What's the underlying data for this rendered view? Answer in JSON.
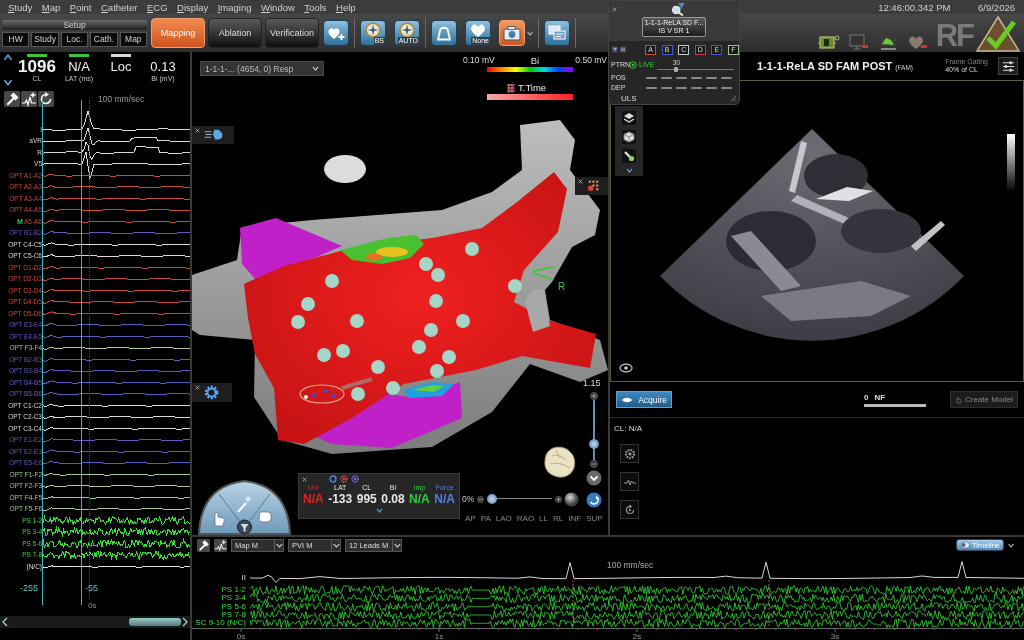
{
  "menu_bar": {
    "items": [
      "Study",
      "Map",
      "Point",
      "Catheter",
      "ECG",
      "Display",
      "Imaging",
      "Window",
      "Tools",
      "Help"
    ],
    "time": "12:46:00.342 PM",
    "date": "6/9/2026"
  },
  "toolbar": {
    "setup_label": "Setup",
    "setup_buttons": [
      "HW",
      "Study",
      "Loc.",
      "Cath.",
      "Map"
    ],
    "mode_tabs": [
      {
        "label": "Mapping",
        "selected": true
      },
      {
        "label": "Ablation",
        "selected": false
      },
      {
        "label": "Verification",
        "selected": false
      }
    ],
    "tool_groups": [
      [
        {
          "kind": "heart-plus",
          "selected": false
        }
      ],
      [
        {
          "kind": "compass",
          "badge": "BS",
          "selected": false
        },
        {
          "kind": "compass",
          "badge": "AUTO",
          "selected": false
        }
      ],
      [
        {
          "kind": "arch",
          "selected": false
        },
        {
          "kind": "heart",
          "badge": "None",
          "selected": false
        },
        {
          "kind": "camera",
          "selected": true
        }
      ],
      [
        {
          "kind": "screens",
          "selected": false
        }
      ]
    ],
    "logo": "RF"
  },
  "uls_panel": {
    "clip_title": "1-1-1-ReLA SD F...",
    "clip_subtitle": "IS V SR 1",
    "channels": [
      {
        "label": "A",
        "color": "#d04a30"
      },
      {
        "label": "B",
        "color": "#4a58c8"
      },
      {
        "label": "C",
        "color": "#c8c8c8"
      },
      {
        "label": "D",
        "color": "#d03838"
      },
      {
        "label": "E",
        "color": "#4a58c8"
      },
      {
        "label": "F",
        "color": "#9ac28e"
      }
    ],
    "pattern_label": "PTRN",
    "live": "LIVE",
    "gain": {
      "value": "30",
      "level": 0.25
    },
    "rows": [
      "POS",
      "DEP"
    ],
    "name": "ULS"
  },
  "ecg_panel": {
    "readouts": [
      {
        "value": "1096",
        "label": "CL",
        "color": "#3cc43c"
      },
      {
        "value": "N/A",
        "label": "LAT (ms)",
        "color": "#3cc43c"
      },
      {
        "value": "Loc",
        "color": "#d8d8d8"
      },
      {
        "value": "0.13",
        "label": "Bi (mV)"
      }
    ],
    "speed": "100 mm/sec",
    "channels": [
      {
        "name": "I",
        "kind": "ecg",
        "color": "#d8d8d8"
      },
      {
        "name": "aVR",
        "kind": "ecg",
        "color": "#d8d8d8"
      },
      {
        "name": "R",
        "kind": "ecg",
        "color": "#d8d8d8"
      },
      {
        "name": "V5",
        "kind": "ecg",
        "color": "#d8d8d8"
      },
      {
        "name": "OPT A1-A2",
        "kind": "flat",
        "color": "#c8483c"
      },
      {
        "name": "OPT A2-A3",
        "kind": "flat",
        "color": "#c8483c"
      },
      {
        "name": "OPT A3-A4",
        "kind": "flat",
        "color": "#c8483c"
      },
      {
        "name": "OPT A4-A5",
        "kind": "flat",
        "color": "#c8483c"
      },
      {
        "name": "A5-A6",
        "marker": "M",
        "kind": "flat",
        "color": "#c8483c"
      },
      {
        "name": "OPT B1-B2",
        "kind": "flat",
        "color": "#5c5cc0"
      },
      {
        "name": "OPT C4-C5",
        "kind": "flat",
        "color": "#dcdcd0"
      },
      {
        "name": "OPT C5-C6",
        "kind": "flat",
        "color": "#dcdcd0"
      },
      {
        "name": "OPT D1-D2",
        "kind": "flat",
        "color": "#c8483c"
      },
      {
        "name": "OPT D2-D3",
        "kind": "flat",
        "color": "#c8483c"
      },
      {
        "name": "OPT D3-D4",
        "kind": "flat",
        "color": "#c8483c"
      },
      {
        "name": "OPT D4-D5",
        "kind": "flat",
        "color": "#c8483c"
      },
      {
        "name": "OPT D5-D6",
        "kind": "flat",
        "color": "#c8483c"
      },
      {
        "name": "OPT E3-E4",
        "kind": "flat",
        "color": "#5c5cc0"
      },
      {
        "name": "OPT E4-E5",
        "kind": "flat",
        "color": "#5c5cc0"
      },
      {
        "name": "OPT F3-F4",
        "kind": "flat",
        "color": "#a8c898"
      },
      {
        "name": "OPT B2-B3",
        "kind": "flat",
        "color": "#5c5cc0"
      },
      {
        "name": "OPT B3-B4",
        "kind": "flat",
        "color": "#5c5cc0"
      },
      {
        "name": "OPT B4-B5",
        "kind": "flat",
        "color": "#5c5cc0"
      },
      {
        "name": "OPT B5-B6",
        "kind": "flat",
        "color": "#5c5cc0"
      },
      {
        "name": "OPT C1-C2",
        "kind": "flat",
        "color": "#dcdcd0"
      },
      {
        "name": "OPT C2-C3",
        "kind": "flat",
        "color": "#dcdcd0"
      },
      {
        "name": "OPT C3-C4",
        "kind": "flat",
        "color": "#dcdcd0"
      },
      {
        "name": "OPT E1-E2",
        "kind": "flat",
        "color": "#5c5cc0"
      },
      {
        "name": "OPT E2-E3",
        "kind": "flat",
        "color": "#5c5cc0"
      },
      {
        "name": "OPT E5-E6",
        "kind": "flat",
        "color": "#5c5cc0"
      },
      {
        "name": "OPT F1-F2",
        "kind": "flat",
        "color": "#a8c898"
      },
      {
        "name": "OPT F2-F3",
        "kind": "flat",
        "color": "#a8c898"
      },
      {
        "name": "OPT F4-F5",
        "kind": "flat",
        "color": "#a8c898"
      },
      {
        "name": "OPT F5-F6",
        "kind": "flat",
        "color": "#a8c898"
      },
      {
        "name": "PS 1-2",
        "kind": "noisy",
        "color": "#33dd33"
      },
      {
        "name": "PS 3-4",
        "kind": "noisy",
        "color": "#33dd33"
      },
      {
        "name": "PS 5-6",
        "kind": "noisy",
        "color": "#33dd33"
      },
      {
        "name": "PS 7-8",
        "kind": "noisy",
        "color": "#33dd33"
      },
      {
        "name": "(N/C)",
        "kind": "flat",
        "color": "#e0e0e0"
      }
    ],
    "cursor_values": [
      "-255",
      "-55"
    ],
    "time_label": "0s"
  },
  "map_view": {
    "map_selector": "1-1-1-... (4654, 0) Resp",
    "legend": {
      "min": "0.10 mV",
      "name": "Bi",
      "max": "0.50 mV",
      "overlay": "T.Time"
    },
    "orientation_label": "R",
    "zoom": {
      "value": "1.15",
      "level": 0.26
    },
    "point_info": [
      {
        "label": "Uni",
        "value": "N/A",
        "color": "#e02424"
      },
      {
        "label": "LAT",
        "value": "-133",
        "color": "#e6e6e6"
      },
      {
        "label": "CL",
        "value": "995",
        "color": "#e6e6e6"
      },
      {
        "label": "Bi",
        "value": "0.08",
        "color": "#e6e6e6"
      },
      {
        "label": "Imp",
        "value": "N/A",
        "color": "#2ecc40"
      },
      {
        "label": "Force",
        "value": "N/A",
        "color": "#4f7fe8"
      }
    ],
    "transparency": {
      "value": "0%",
      "level": 0.08
    },
    "views": [
      "AP",
      "PA",
      "LAO",
      "RAO",
      "LL",
      "RL",
      "INF",
      "SUP"
    ]
  },
  "ultrasound_view": {
    "title": "1-1-1-ReLA SD FAM POST",
    "mode": "(FAM)",
    "gating_label": "Frame Gating",
    "gating_value": "40% of CL",
    "acquire": "Acquire",
    "frame_count": "0",
    "frame_unit": "NF",
    "create_model": {
      "label": "Create Model",
      "disabled": true
    },
    "cycle_length": "CL: N/A"
  },
  "timeline": {
    "dropdowns": [
      "Map M",
      "PVI M",
      "12 Leads M"
    ],
    "toggle": {
      "label": "Timeline",
      "on": true
    },
    "speed": "100 mm/sec",
    "channels": [
      {
        "name": "II",
        "kind": "ecg"
      },
      {
        "name": "PS 1-2",
        "kind": "noisy"
      },
      {
        "name": "PS 3-4",
        "kind": "noisy"
      },
      {
        "name": "PS 5-6",
        "kind": "noisy"
      },
      {
        "name": "PS 7-8",
        "kind": "noisy"
      },
      {
        "name": "SC 9-10 (N/C)",
        "kind": "noisy"
      }
    ],
    "ticks": [
      "0s",
      "1s",
      "2s",
      "3s"
    ]
  }
}
